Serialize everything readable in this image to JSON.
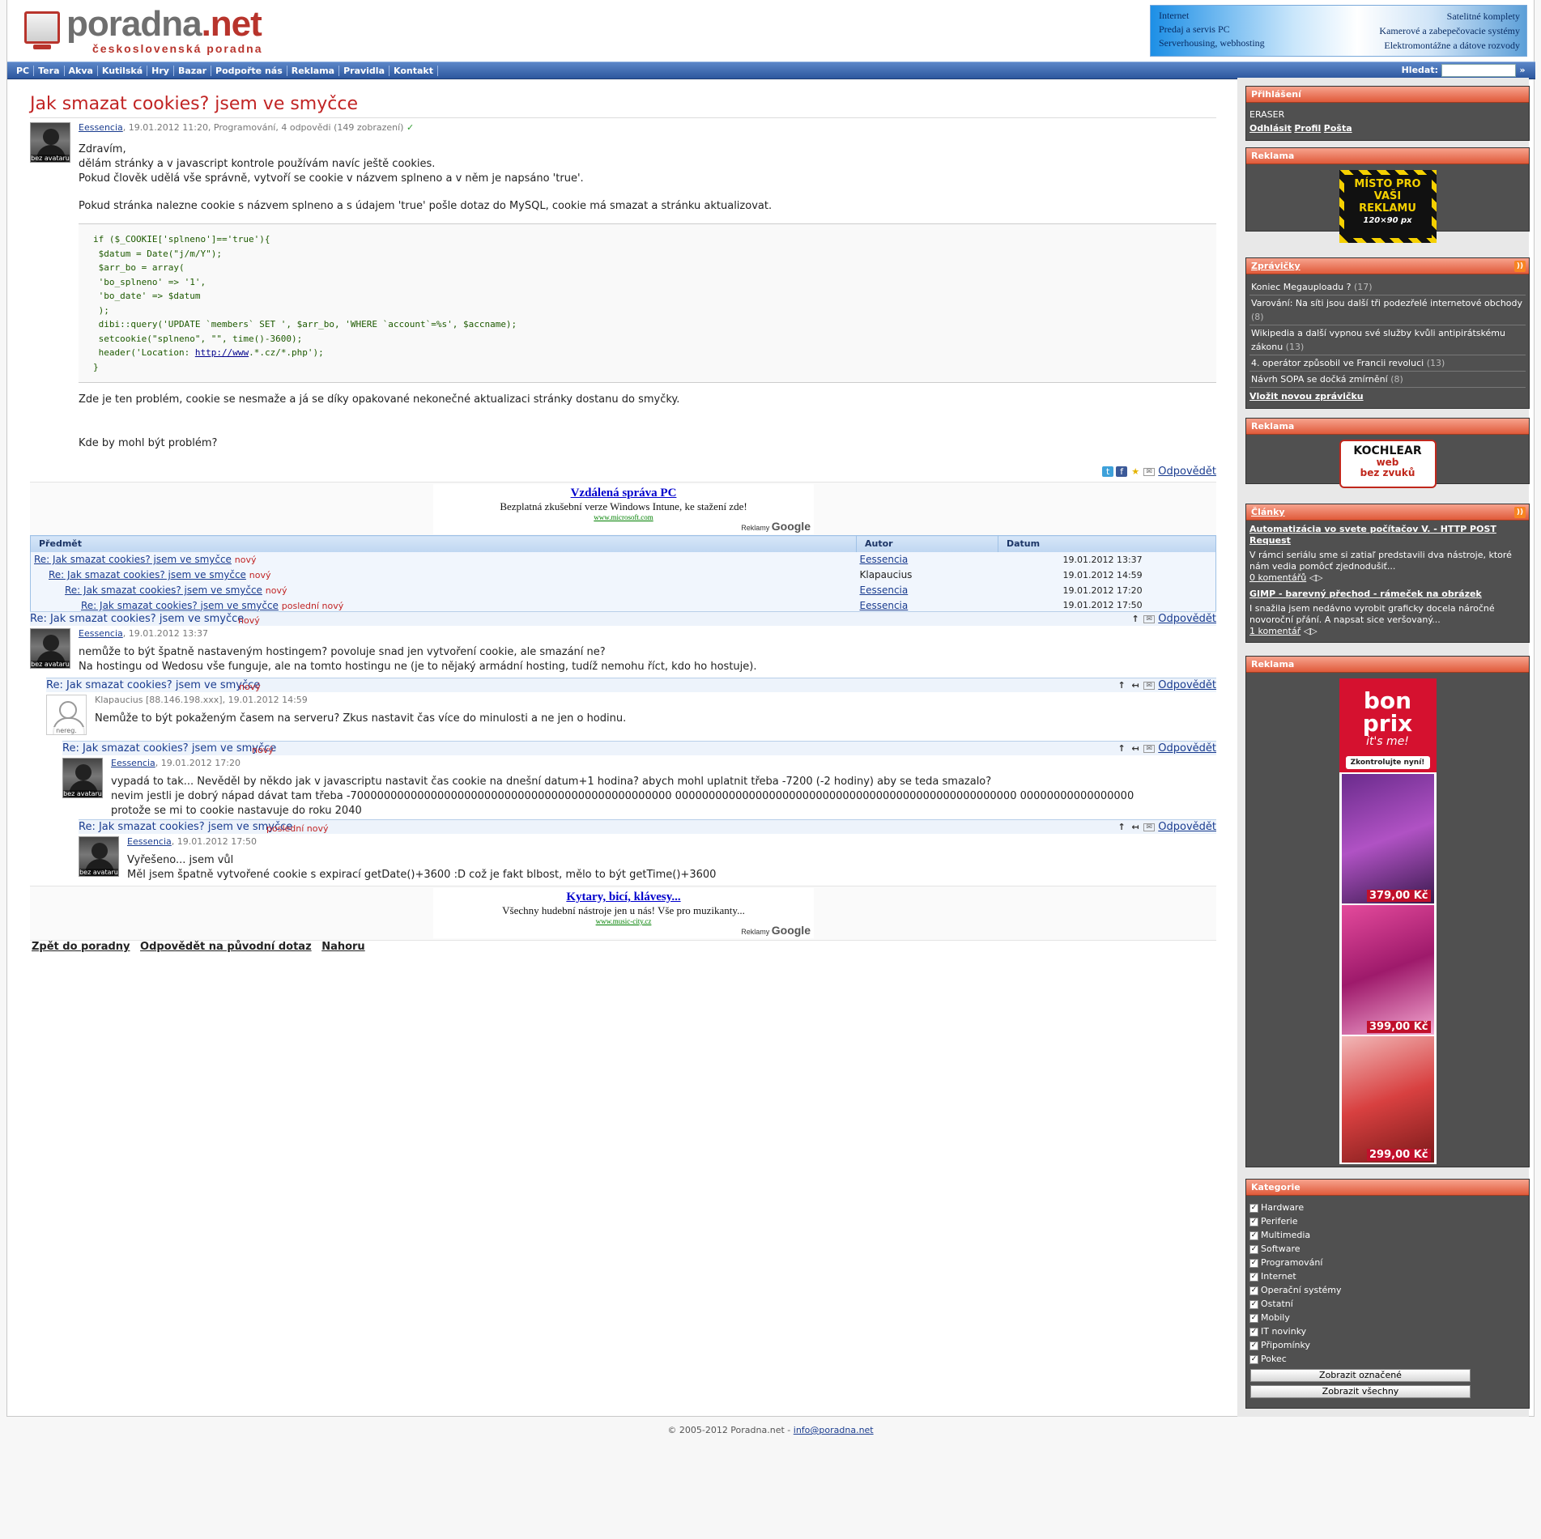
{
  "logo": {
    "brand_a": "poradna",
    "brand_b": ".net",
    "sub": "československá poradna"
  },
  "header_banner": {
    "left": [
      "Internet",
      "Predaj a servis PC",
      "Serverhousing, webhosting"
    ],
    "right": [
      "Satelitné komplety",
      "Kamerové a zabepečovacie systémy",
      "Elektromontážne a dátove rozvody"
    ]
  },
  "nav": {
    "items": [
      "PC",
      "Tera",
      "Akva",
      "Kutilská",
      "Hry",
      "Bazar",
      "Podpořte nás",
      "Reklama",
      "Pravidla",
      "Kontakt"
    ],
    "search_label": "Hledat:",
    "search_go": "»"
  },
  "question": {
    "title": "Jak smazat cookies? jsem ve smyčce",
    "avatar": "bez avataru",
    "author": "Eessencia",
    "meta": ", 19.01.2012 11:20, Programování, 4 odpovědi (149 zobrazení)",
    "check": "✓",
    "p1": "Zdravím,",
    "p2": "dělám stránky a v javascript kontrole používám navíc ještě cookies.",
    "p3": "Pokud člověk udělá vše správně, vytvoří se cookie v názvem splneno a v něm je napsáno 'true'.",
    "p4": "Pokud stránka nalezne cookie s názvem splneno a s údajem 'true' pošle dotaz do MySQL, cookie má smazat a stránku aktualizovat.",
    "code": [
      "if ($_COOKIE['splneno']=='true'){",
      " $datum = Date(\"j/m/Y\");",
      " $arr_bo = array(",
      " 'bo_splneno' => '1',",
      " 'bo_date' => $datum",
      " );",
      " dibi::query('UPDATE `members` SET ', $arr_bo, 'WHERE `account`=%s', $accname);",
      " setcookie(\"splneno\", \"\", time()-3600);"
    ],
    "code_loc_a": " header('Location: ",
    "code_loc_link": "http://www",
    "code_loc_b": ".*.cz/*.php');",
    "code_end": "}",
    "p5": "Zde je ten problém, cookie se nesmaže a já se díky opakované nekonečné aktualizaci stránky dostanu do smyčky.",
    "p6": "Kde by mohl být problém?",
    "reply": "Odpovědět"
  },
  "ad1": {
    "title": "Vzdálená správa PC",
    "desc": "Bezplatná zkušební verze Windows Intune, ke stažení zde!",
    "url": "www.microsoft.com",
    "label": "Reklamy",
    "brand": "Google"
  },
  "ad2": {
    "title": "Kytary, bicí, klávesy...",
    "desc": "Všechny hudební nástroje jen u nás! Vše pro muzikanty...",
    "url": "www.music-city.cz",
    "label": "Reklamy",
    "brand": "Google"
  },
  "thread": {
    "headers": [
      "Předmět",
      "Autor",
      "Datum"
    ],
    "rows": [
      {
        "subject": "Re: Jak smazat cookies? jsem ve smyčce",
        "tag": "nový",
        "author": "Eessencia",
        "date": "19.01.2012 13:37"
      },
      {
        "subject": "Re: Jak smazat cookies? jsem ve smyčce",
        "tag": "nový",
        "author": "Klapaucius",
        "date": "19.01.2012 14:59"
      },
      {
        "subject": "Re: Jak smazat cookies? jsem ve smyčce",
        "tag": "nový",
        "author": "Eessencia",
        "date": "19.01.2012 17:20"
      },
      {
        "subject": "Re: Jak smazat cookies? jsem ve smyčce",
        "tag": "poslední nový",
        "author": "Eessencia",
        "date": "19.01.2012 17:50"
      }
    ]
  },
  "replies": [
    {
      "subject": "Re: Jak smazat cookies? jsem ve smyčce",
      "tag": "nový",
      "author": "Eessencia",
      "meta": ", 19.01.2012 13:37",
      "avatar": "bez avataru",
      "lines": [
        "nemůže to být špatně nastaveným hostingem? povoluje snad jen vytvoření cookie, ale smazání ne?",
        "Na hostingu od Wedosu vše funguje, ale na tomto hostingu ne (je to nějaký armádní hosting, tudíž nemohu říct, kdo ho hostuje)."
      ]
    },
    {
      "subject": "Re: Jak smazat cookies? jsem ve smyčce",
      "tag": "nový",
      "author": "Klapaucius [88.146.198.xxx]",
      "meta": ", 19.01.2012 14:59",
      "avatar": "nereg.",
      "lines": [
        "Nemůže to být pokaženým časem na serveru? Zkus nastavit čas více do minulosti a ne jen o hodinu."
      ]
    },
    {
      "subject": "Re: Jak smazat cookies? jsem ve smyčce",
      "tag": "nový",
      "author": "Eessencia",
      "meta": ", 19.01.2012 17:20",
      "avatar": "bez avataru",
      "lines": [
        "vypadá to tak... Nevěděl by někdo jak v javascriptu nastavit čas cookie na dnešní datum+1 hodina? abych mohl uplatnit třeba -7200 (-2 hodiny) aby se teda smazalo?",
        "nevim jestli je dobrý nápad dávat tam třeba -700000000000000000000000000000000000000000000000 000000000000000000000000000000000000000000000000000 00000000000000000",
        "protože se mi to cookie nastavuje do roku 2040"
      ]
    },
    {
      "subject": "Re: Jak smazat cookies? jsem ve smyčce",
      "tag": "poslední nový",
      "author": "Eessencia",
      "meta": ", 19.01.2012 17:50",
      "avatar": "bez avataru",
      "lines": [
        "Vyřešeno... jsem vůl",
        "Měl jsem špatně vytvořené cookie s expirací getDate()+3600 :D což je fakt blbost, mělo to být getTime()+3600"
      ]
    }
  ],
  "footer_links": [
    "Zpět do poradny",
    "Odpovědět na původní dotaz",
    "Nahoru"
  ],
  "sidebar": {
    "login": {
      "title": "Přihlášení",
      "user": "ERASER",
      "links": [
        "Odhlásit",
        "Profil",
        "Pošta"
      ]
    },
    "ad_title": "Reklama",
    "ad_place": {
      "l1": "MÍSTO PRO",
      "l2": "VAŠI",
      "l3": "REKLAMU",
      "l4": "120×90 px"
    },
    "kochlear": {
      "brand": "KOCHLEAR",
      "l1": "web",
      "l2": "bez zvuků"
    },
    "news": {
      "title": "Zprávičky",
      "items": [
        {
          "t": "Koniec Megauploadu ?",
          "n": "(17)"
        },
        {
          "t": "Varování: Na síti jsou další tři podezřelé internetové obchody",
          "n": "(8)"
        },
        {
          "t": "Wikipedia a další vypnou své služby kvůli antipirátskému zákonu",
          "n": "(13)"
        },
        {
          "t": "4. operátor způsobil ve Francii revoluci",
          "n": "(13)"
        },
        {
          "t": "Návrh SOPA se dočká zmírnění",
          "n": "(8)"
        }
      ],
      "add": "Vložit novou zprávičku"
    },
    "articles": {
      "title": "Články",
      "items": [
        {
          "t": "Automatizácia vo svete počítačov V. - HTTP POST Request",
          "d": "V rámci seriálu sme si zatiaľ predstavili dva nástroje, ktoré nám vedia pomôcť zjednodušiť...",
          "c": "0 komentářů"
        },
        {
          "t": "GIMP - barevný přechod - rámeček na obrázek",
          "d": "I snažila jsem nedávno vyrobit graficky docela náročné novoroční přání. A napsat sice veršovaný...",
          "c": "1 komentář"
        }
      ]
    },
    "bonprix": {
      "brand": "bon prix",
      "slogan": "it's me!",
      "cta": "Zkontrolujte nyní!",
      "prices": [
        "379,00 Kč",
        "399,00 Kč",
        "299,00 Kč"
      ]
    },
    "categories": {
      "title": "Kategorie",
      "items": [
        "Hardware",
        "Periferie",
        "Multimedia",
        "Software",
        "Programování",
        "Internet",
        "Operační systémy",
        "Ostatní",
        "Mobily",
        "IT novinky",
        "Připomínky",
        "Pokec"
      ],
      "btn1": "Zobrazit označené",
      "btn2": "Zobrazit všechny"
    }
  },
  "copyright": {
    "text": "© 2005-2012 Poradna.net - ",
    "email": "info@poradna.net"
  }
}
